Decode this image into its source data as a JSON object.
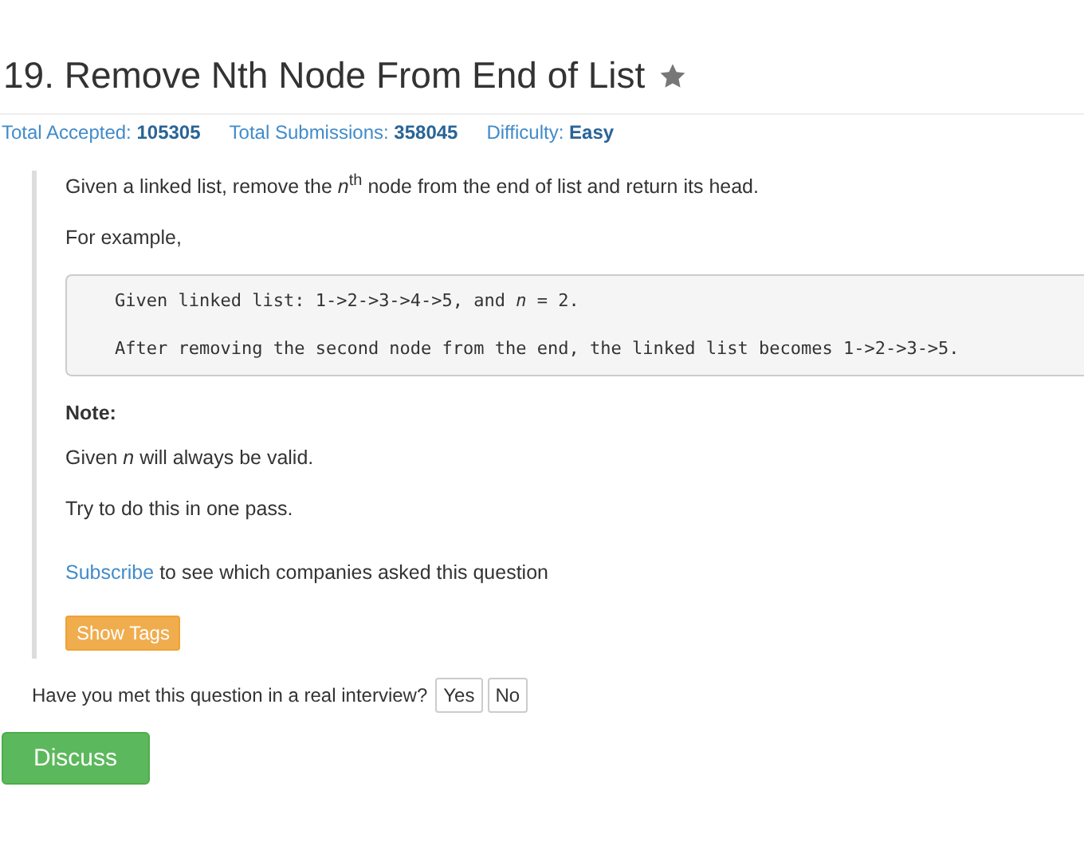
{
  "title": "19. Remove Nth Node From End of List",
  "starred": false,
  "stats": [
    {
      "label": "Total Accepted:",
      "value": "105305"
    },
    {
      "label": "Total Submissions:",
      "value": "358045"
    },
    {
      "label": "Difficulty:",
      "value": "Easy"
    }
  ],
  "description": "Given a linked list, remove the *n*$^{th}$ node from the end of list and return its head.",
  "example_intro": "For example,",
  "code_lines": [
    "Given linked list: 1->2->3->4->5, and *n* = 2.",
    "After removing the second node from the end, the linked list becomes 1->2->3->5."
  ],
  "note_title": "Note:",
  "notes": [
    "Given *n* will always be valid.",
    "Try to do this in one pass."
  ],
  "subscribe": {
    "link": "Subscribe",
    "text": "to see which companies asked this question"
  },
  "show_tags_button": "Show Tags",
  "interview": {
    "question": "Have you met this question in a real interview?",
    "buttons": [
      "Yes",
      "No"
    ]
  },
  "discuss_button": "Discuss"
}
